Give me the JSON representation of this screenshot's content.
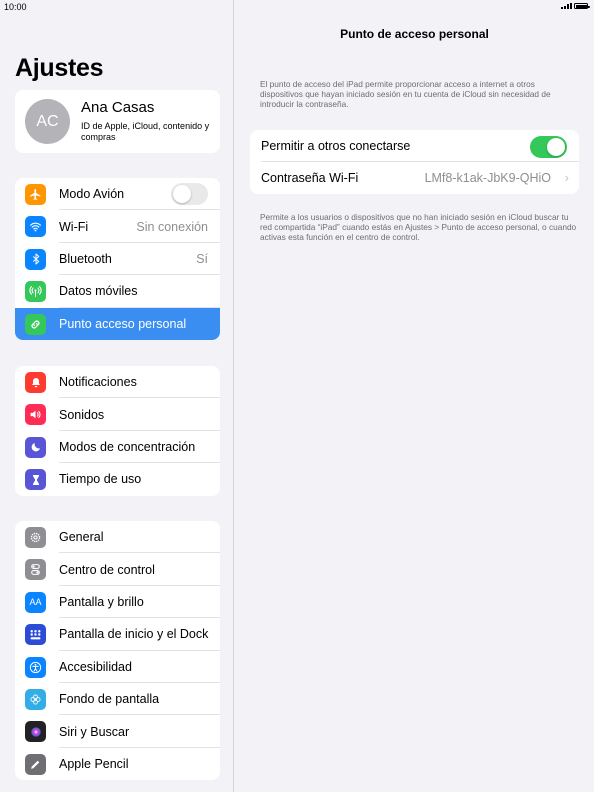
{
  "status_bar": {
    "time": "10:00"
  },
  "sidebar": {
    "title": "Ajustes",
    "profile": {
      "initials": "AC",
      "name": "Ana Casas",
      "subtitle": "ID de Apple, iCloud, contenido y compras"
    },
    "group1": [
      {
        "label": "Modo Avión",
        "icon": "airplane-icon",
        "color": "#ff9500",
        "toggle": false
      },
      {
        "label": "Wi-Fi",
        "icon": "wifi-icon",
        "color": "#0a84ff",
        "value": "Sin conexión"
      },
      {
        "label": "Bluetooth",
        "icon": "bluetooth-icon",
        "color": "#0a84ff",
        "value": "Sí"
      },
      {
        "label": "Datos móviles",
        "icon": "antenna-icon",
        "color": "#34c759"
      },
      {
        "label": "Punto acceso personal",
        "icon": "hotspot-icon",
        "color": "#34c759",
        "selected": true
      }
    ],
    "group2": [
      {
        "label": "Notificaciones",
        "icon": "bell-icon",
        "color": "#ff3b30"
      },
      {
        "label": "Sonidos",
        "icon": "speaker-icon",
        "color": "#ff2d55"
      },
      {
        "label": "Modos de concentración",
        "icon": "moon-icon",
        "color": "#5856d6"
      },
      {
        "label": "Tiempo de uso",
        "icon": "hourglass-icon",
        "color": "#5856d6"
      }
    ],
    "group3": [
      {
        "label": "General",
        "icon": "gear-icon",
        "color": "#8e8e93"
      },
      {
        "label": "Centro de control",
        "icon": "switches-icon",
        "color": "#8e8e93"
      },
      {
        "label": "Pantalla y brillo",
        "icon": "text-size-icon",
        "color": "#0a84ff"
      },
      {
        "label": "Pantalla de inicio y el Dock",
        "icon": "home-grid-icon",
        "color": "#2c4bd6"
      },
      {
        "label": "Accesibilidad",
        "icon": "accessibility-icon",
        "color": "#0a84ff"
      },
      {
        "label": "Fondo de pantalla",
        "icon": "flower-icon",
        "color": "#32ade6"
      },
      {
        "label": "Siri y Buscar",
        "icon": "siri-icon",
        "color": "#222222"
      },
      {
        "label": "Apple Pencil",
        "icon": "pencil-icon",
        "color": "#6e6e73"
      }
    ]
  },
  "detail": {
    "title": "Punto de acceso personal",
    "description": "El punto de acceso del iPad permite proporcionar acceso a internet a otros dispositivos que hayan iniciado sesión en tu cuenta de iCloud sin necesidad de introducir la contraseña.",
    "allow_label": "Permitir a otros conectarse",
    "allow_on": true,
    "password_label": "Contraseña Wi-Fi",
    "password_value": "LMf8-k1ak-JbK9-QHiO",
    "footer": "Permite a los usuarios o dispositivos que no han iniciado sesión en iCloud buscar tu red compartida “iPad” cuando estás en Ajustes > Punto de acceso personal, o cuando activas esta función en el centro de control."
  }
}
